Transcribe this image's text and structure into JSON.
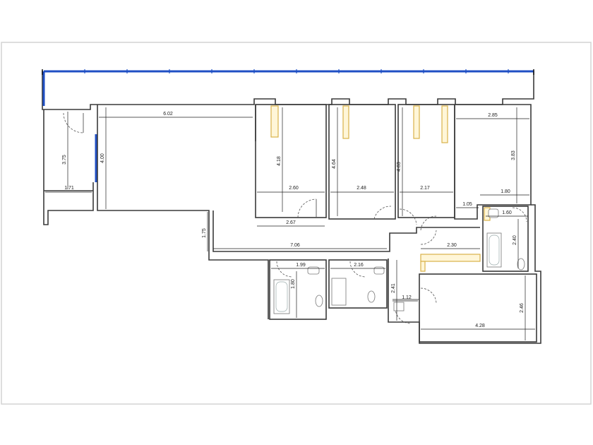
{
  "plan": {
    "colors": {
      "wall": "#3a3a3a",
      "window": "#1f4fc4",
      "wardrobe": "#d9b24a",
      "frame": "#d4d4d4"
    },
    "dimensions": {
      "living_width": "6.02",
      "living_height": "4.00",
      "entry_height": "3.75",
      "entry_width": "1.71",
      "bedroom1_height": "4.18",
      "bedroom1_width": "2.60",
      "bedroom1_lower_width": "2.67",
      "bedroom2_height": "4.64",
      "bedroom2_width": "2.48",
      "bedroom3_height": "4.63",
      "bedroom3_width": "2.17",
      "bedroom4_width": "2.85",
      "bedroom4_height": "3.83",
      "hall_upper_width": "1.80",
      "hall_step": "1.05",
      "bath3_width": "1.60",
      "bath3_height": "2.40",
      "corridor_mid": "2.30",
      "corridor_step": "1.75",
      "corridor_length": "7.06",
      "bath1_width": "1.99",
      "bath1_height": "1.80",
      "bath2_width": "2.16",
      "kitchen_lobby_height": "2.41",
      "kitchen_lobby_width": "1.12",
      "kitchen_width": "4.28",
      "kitchen_height": "2.46"
    }
  }
}
